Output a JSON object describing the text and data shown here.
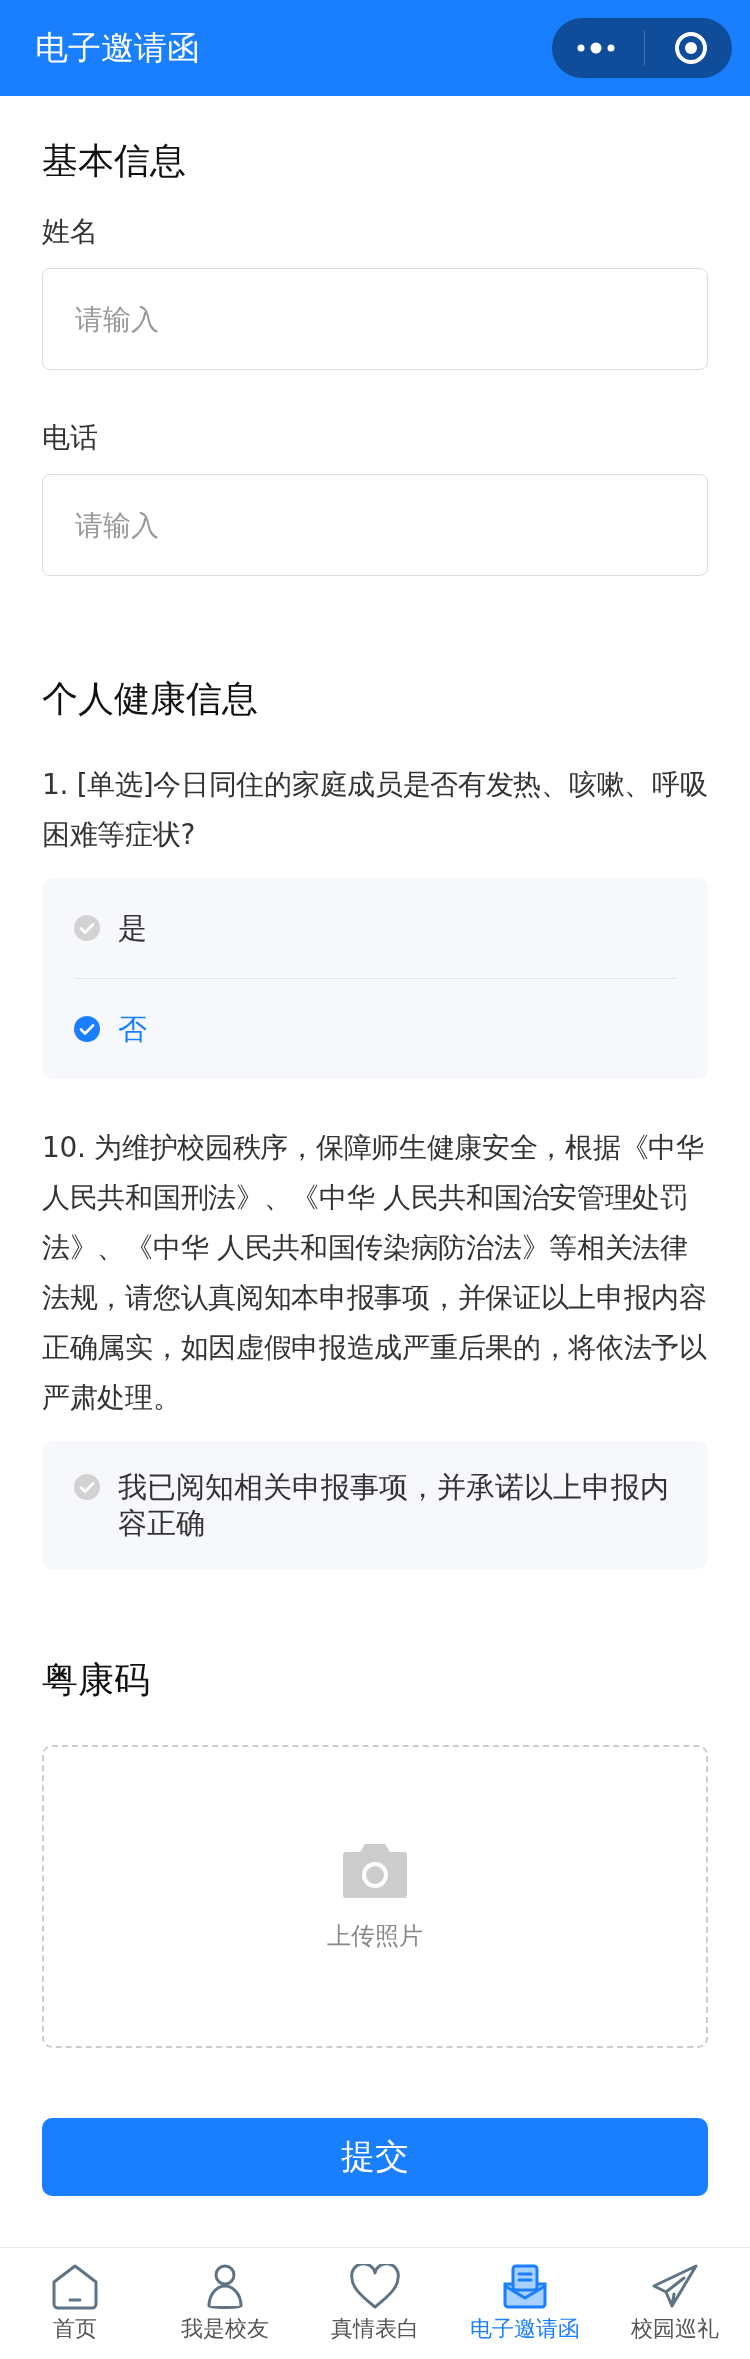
{
  "header": {
    "title": "电子邀请函"
  },
  "basic": {
    "title": "基本信息",
    "fields": [
      {
        "label": "姓名",
        "placeholder": "请输入"
      },
      {
        "label": "电话",
        "placeholder": "请输入"
      }
    ]
  },
  "health": {
    "title": "个人健康信息",
    "questions": [
      {
        "kind": "choice",
        "text": "1. [单选]今日同住的家庭成员是否有发热、咳嗽、呼吸困难等症状?",
        "options": [
          {
            "label": "是",
            "selected": false
          },
          {
            "label": "否",
            "selected": true
          }
        ]
      },
      {
        "kind": "agreement",
        "text": "10. 为维护校园秩序，保障师生健康安全，根据《中华人民共和国刑法》、《中华 人民共和国治安管理处罚法》、《中华 人民共和国传染病防治法》等相关法律法规，请您认真阅知本申报事项，并保证以上申报内容正确属实，如因虚假申报造成严重后果的，将依法予以严肃处理。",
        "options": [
          {
            "label": "我已阅知相关申报事项，并承诺以上申报内容正确",
            "selected": false
          }
        ]
      }
    ]
  },
  "health_code": {
    "title": "粤康码",
    "upload": {
      "label": "上传照片"
    }
  },
  "submit": {
    "label": "提交"
  },
  "tabbar": [
    {
      "label": "首页",
      "selected": false
    },
    {
      "label": "我是校友",
      "selected": false
    },
    {
      "label": "真情表白",
      "selected": false
    },
    {
      "label": "电子邀请函",
      "selected": true
    },
    {
      "label": "校园巡礼",
      "selected": false
    }
  ]
}
